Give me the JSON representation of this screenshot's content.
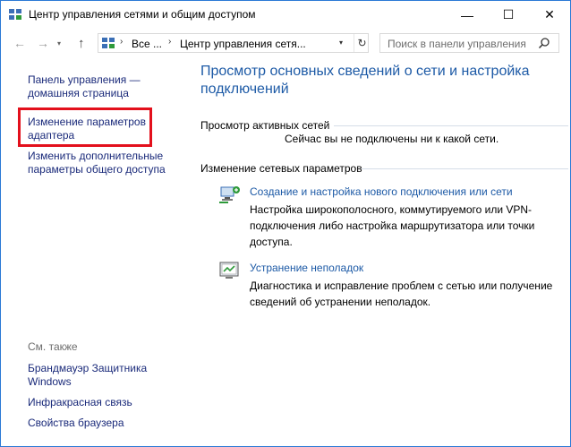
{
  "window": {
    "title": "Центр управления сетями и общим доступом",
    "minimize_symbol": "—",
    "maximize_symbol": "☐",
    "close_symbol": "✕"
  },
  "nav": {
    "back_symbol": "←",
    "forward_symbol": "→",
    "history_symbol": "▾",
    "up_symbol": "↑"
  },
  "address": {
    "crumbs": [
      "Все ...",
      "Центр управления сетя..."
    ],
    "separator": "›",
    "dropdown_symbol": "▾",
    "refresh_symbol": "↻"
  },
  "search": {
    "placeholder": "Поиск в панели управления"
  },
  "sidebar": {
    "links": [
      "Панель управления — домашняя страница",
      "Изменение параметров адаптера",
      "Изменить дополнительные параметры общего доступа"
    ],
    "see_also_heading": "См. также",
    "see_also": [
      "Брандмауэр Защитника Windows",
      "Инфракрасная связь",
      "Свойства браузера"
    ]
  },
  "main": {
    "title": "Просмотр основных сведений о сети и настройка подключений",
    "active_networks_heading": "Просмотр активных сетей",
    "no_connection_text": "Сейчас вы не подключены ни к какой сети.",
    "change_settings_heading": "Изменение сетевых параметров",
    "tasks": [
      {
        "icon": "new-connection-icon",
        "link": "Создание и настройка нового подключения или сети",
        "desc": "Настройка широкополосного, коммутируемого или VPN-подключения либо настройка маршрутизатора или точки доступа."
      },
      {
        "icon": "troubleshoot-icon",
        "link": "Устранение неполадок",
        "desc": "Диагностика и исправление проблем с сетью или получение сведений об устранении неполадок."
      }
    ]
  },
  "colors": {
    "link": "#1d5aa6",
    "sidebar_link": "#1a2a7a",
    "highlight": "#e3101c",
    "border": "#2b79d6"
  }
}
